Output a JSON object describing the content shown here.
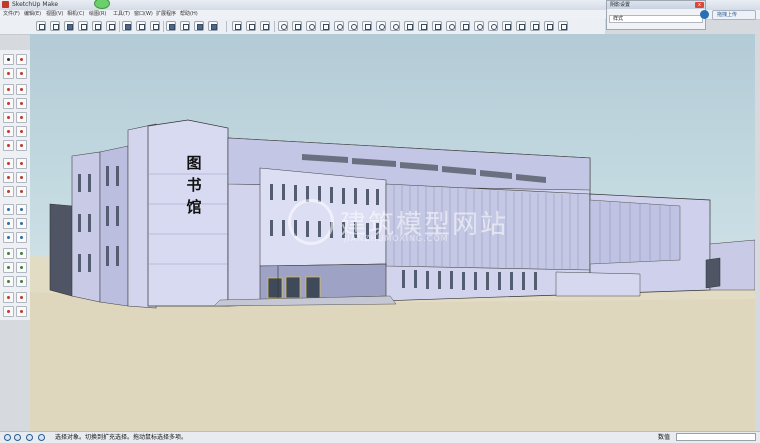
{
  "window": {
    "title": "SketchUp Make"
  },
  "menu": {
    "items": [
      "文件(F)",
      "编辑(E)",
      "视图(V)",
      "相机(C)",
      "绘图(R)",
      "工具(T)",
      "窗口(W)",
      "扩展程序",
      "帮助(H)"
    ]
  },
  "tray": {
    "header": "阴影设置",
    "row_label": "样式",
    "close": "x"
  },
  "upload": {
    "label": "拖拽上传"
  },
  "building": {
    "sign": [
      "图",
      "书",
      "馆"
    ]
  },
  "watermark": {
    "text": "建筑模型网站",
    "sub": "JIANZHUMOXING.COM"
  },
  "status": {
    "hint": "选择对象。切换到扩充选择。拖动鼠标选择多项。",
    "measure_label": "数值"
  }
}
